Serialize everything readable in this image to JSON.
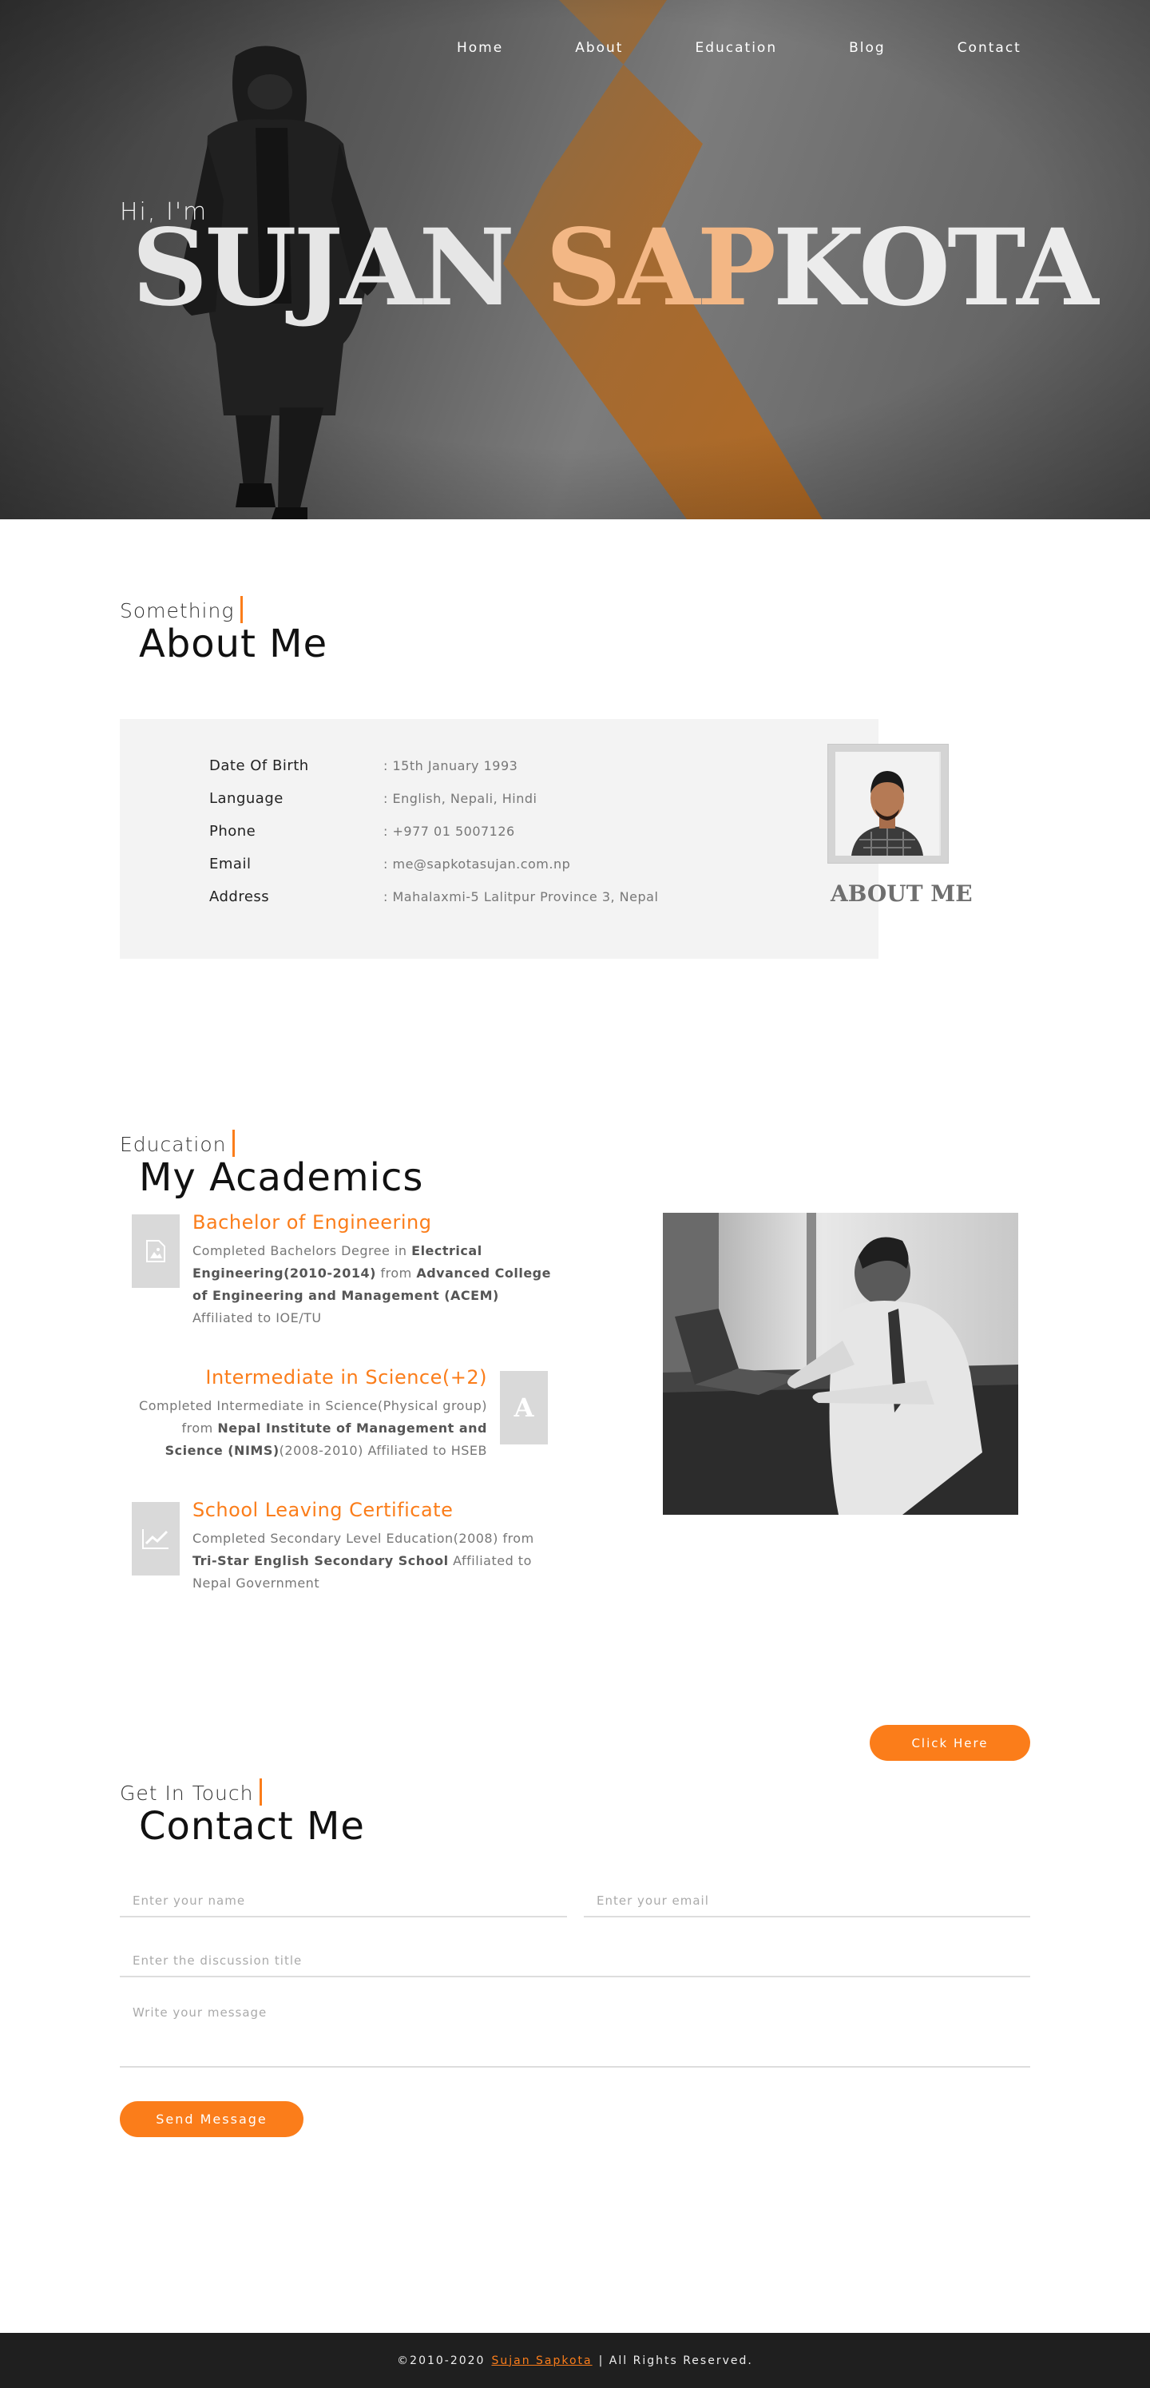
{
  "nav": {
    "items": [
      "Home",
      "About",
      "Education",
      "Blog",
      "Contact"
    ]
  },
  "hero": {
    "greeting": "Hi, I'm",
    "name_first": "SUJAN",
    "name_last_accent": "SAP",
    "name_last_rest": "KOTA"
  },
  "about": {
    "kicker": "Something",
    "title": "About Me",
    "rows": [
      {
        "label": "Date Of Birth",
        "value": ": 15th January 1993"
      },
      {
        "label": "Language",
        "value": ": English, Nepali, Hindi"
      },
      {
        "label": "Phone",
        "value": ": +977 01 5007126"
      },
      {
        "label": "Email",
        "value": ": me@sapkotasujan.com.np"
      },
      {
        "label": "Address",
        "value": ": Mahalaxmi-5 Lalitpur Province 3, Nepal"
      }
    ],
    "signature": "ABOUT ME"
  },
  "education": {
    "kicker": "Education",
    "title": "My Academics",
    "items": [
      {
        "title": "Bachelor of Engineering",
        "icon": "image-icon",
        "desc_1": "Completed Bachelors Degree in ",
        "desc_b1": "Electrical Engineering(2010-2014)",
        "desc_2": " from ",
        "desc_b2": "Advanced College of Engineering and Management (ACEM)",
        "desc_3": " Affiliated to IOE/TU"
      },
      {
        "title": "Intermediate in Science(+2)",
        "icon": "letter-a-icon",
        "icon_glyph": "A",
        "desc_1": "Completed Intermediate in Science(Physical group) from ",
        "desc_b1": "Nepal Institute of Management and Science (NIMS)",
        "desc_2": "(2008-2010) Affiliated to HSEB"
      },
      {
        "title": "School Leaving Certificate",
        "icon": "chart-line-icon",
        "desc_1": "Completed Secondary Level Education(2008) from ",
        "desc_b1": "Tri-Star English Secondary School",
        "desc_2": " Affiliated to Nepal Government"
      }
    ],
    "button": "Click Here"
  },
  "contact": {
    "kicker": "Get In Touch",
    "title": "Contact Me",
    "name_placeholder": "Enter your name",
    "email_placeholder": "Enter your email",
    "subject_placeholder": "Enter the discussion title",
    "message_placeholder": "Write your message",
    "button": "Send Message"
  },
  "footer": {
    "prefix": "©2010-2020",
    "link": "Sujan Sapkota",
    "suffix": "| All Rights Reserved."
  },
  "colors": {
    "accent": "#fb7d1a",
    "footer_bg": "#1f1f1f",
    "panel_bg": "#f3f3f3"
  }
}
